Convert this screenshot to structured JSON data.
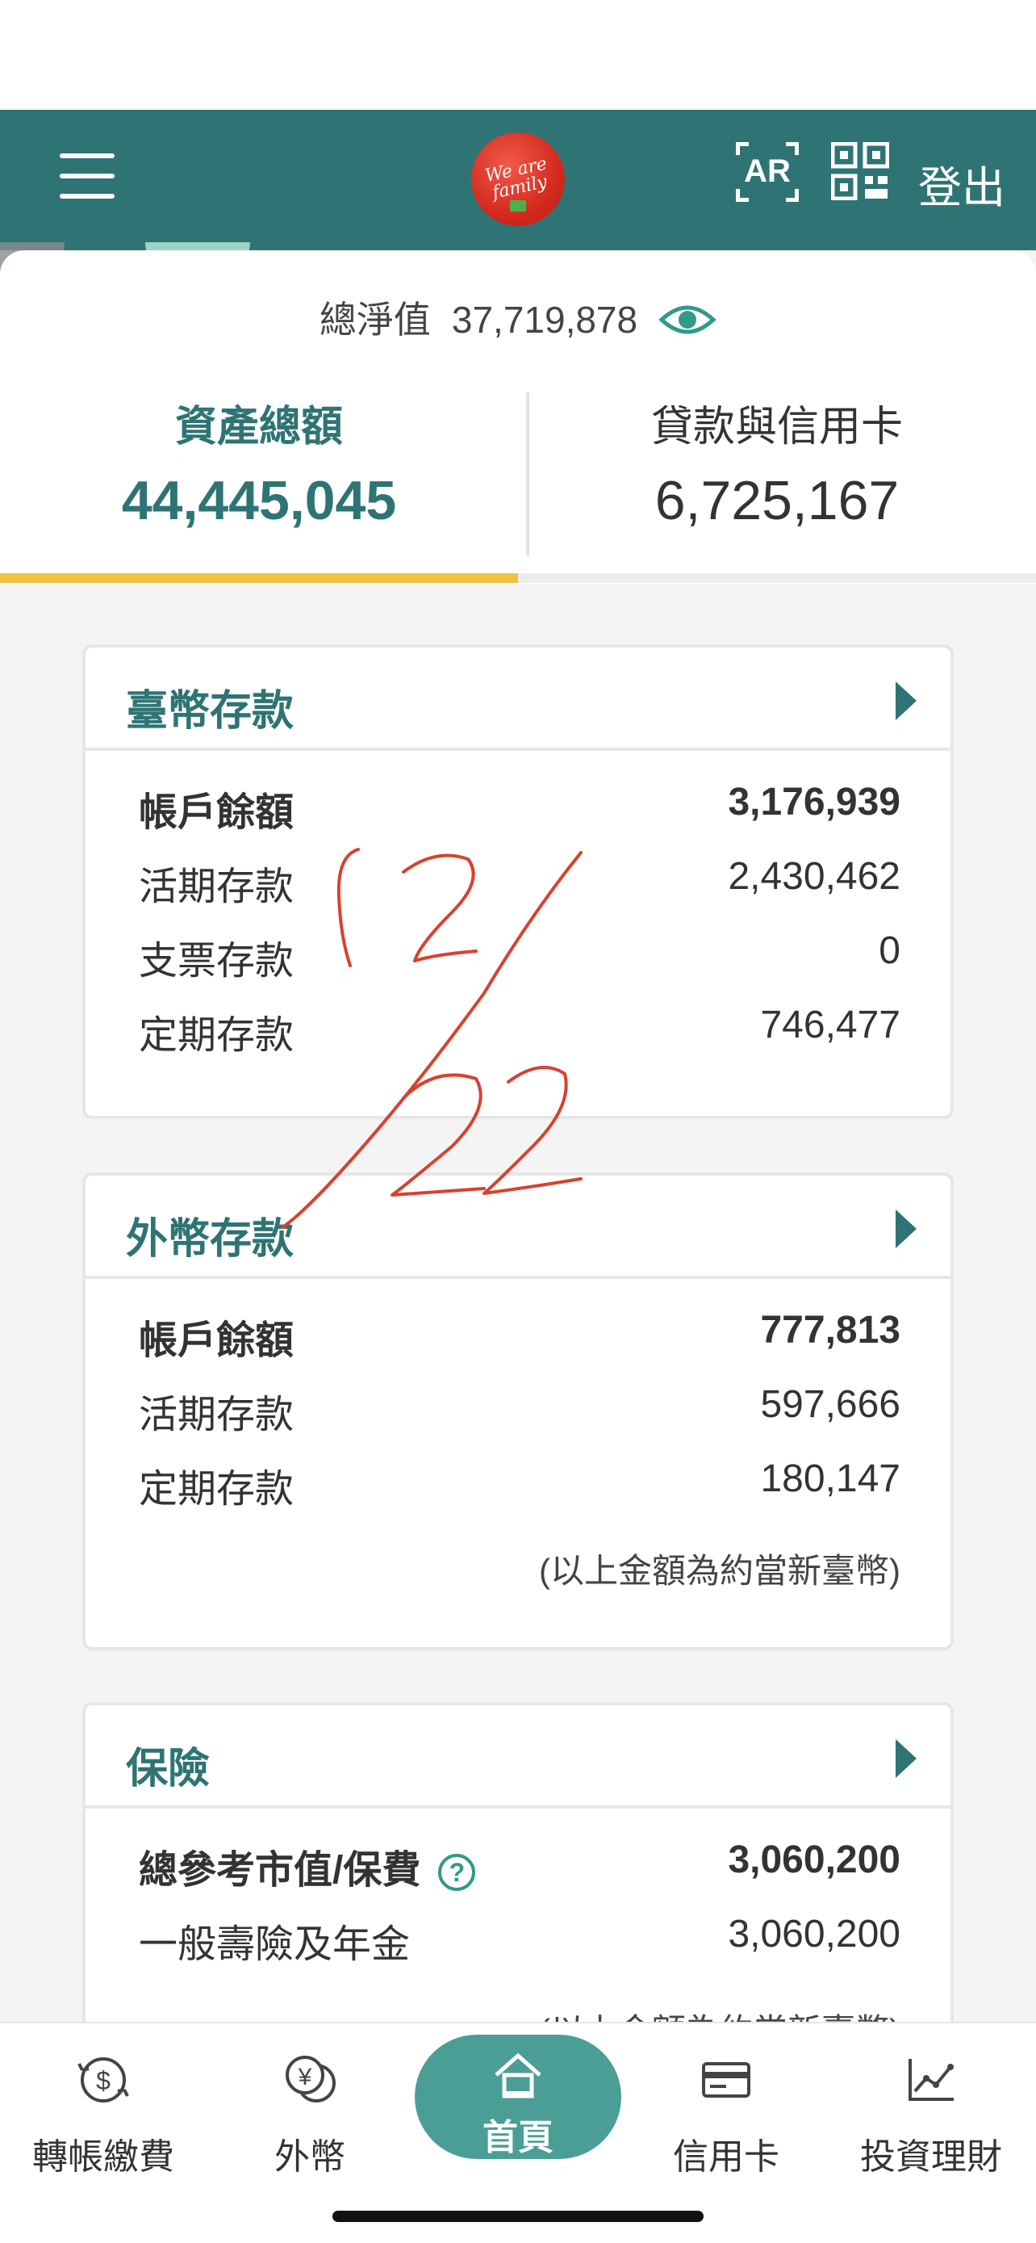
{
  "header": {
    "logo_text": "We are family",
    "ar_label": "AR",
    "logout_label": "登出"
  },
  "summary": {
    "net_worth_label": "總淨值",
    "net_worth_value": "37,719,878",
    "tabs": [
      {
        "title": "資產總額",
        "value": "44,445,045",
        "active": true
      },
      {
        "title": "貸款與信用卡",
        "value": "6,725,167",
        "active": false
      }
    ]
  },
  "twd_deposits": {
    "title": "臺幣存款",
    "rows": [
      {
        "label": "帳戶餘額",
        "value": "3,176,939"
      },
      {
        "label": "活期存款",
        "value": "2,430,462"
      },
      {
        "label": "支票存款",
        "value": "0"
      },
      {
        "label": "定期存款",
        "value": "746,477"
      }
    ]
  },
  "fx_deposits": {
    "title": "外幣存款",
    "rows": [
      {
        "label": "帳戶餘額",
        "value": "777,813"
      },
      {
        "label": "活期存款",
        "value": "597,666"
      },
      {
        "label": "定期存款",
        "value": "180,147"
      }
    ],
    "note": "(以上金額為約當新臺幣)"
  },
  "insurance": {
    "title": "保險",
    "rows": [
      {
        "label": "總參考市值/保費",
        "value": "3,060,200"
      },
      {
        "label": "一般壽險及年金",
        "value": "3,060,200"
      }
    ],
    "help_glyph": "?",
    "note_partial": "(以上金額為約當新臺幣)"
  },
  "bottom_nav": {
    "items": [
      {
        "label": "轉帳繳費",
        "icon": "transfer-dollar-icon"
      },
      {
        "label": "外幣",
        "icon": "yen-coins-icon"
      },
      {
        "label": "首頁",
        "icon": "home-icon"
      },
      {
        "label": "信用卡",
        "icon": "credit-card-icon"
      },
      {
        "label": "投資理財",
        "icon": "line-chart-icon"
      }
    ]
  },
  "colors": {
    "brand_teal": "#2f7474",
    "accent_yellow": "#f0c040",
    "home_button": "#4a9e96",
    "scribble_red": "#d8412e"
  }
}
